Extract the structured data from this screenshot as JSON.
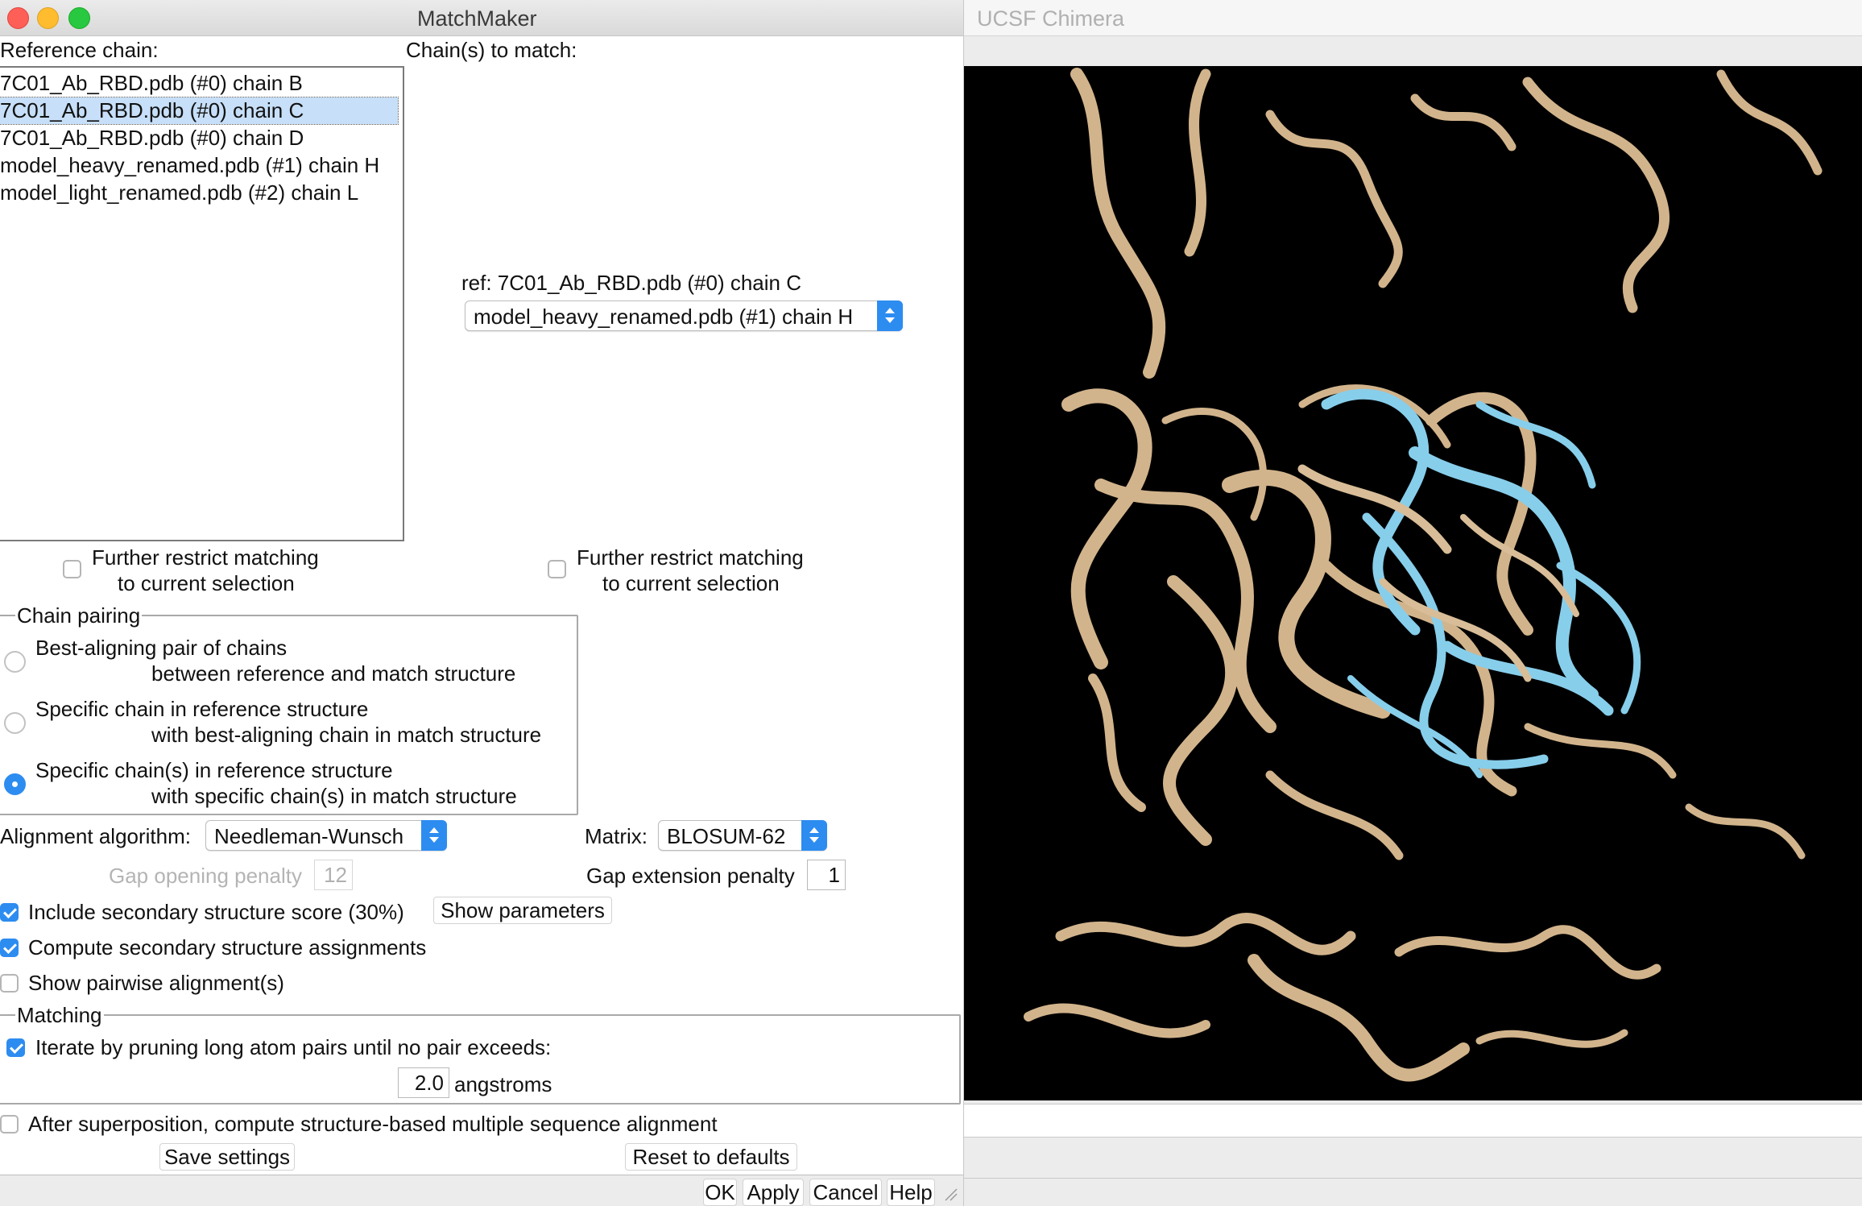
{
  "matchmaker": {
    "title": "MatchMaker",
    "reference_chain_label": "Reference chain:",
    "chains_to_match_label": "Chain(s) to match:",
    "reference_chains": [
      {
        "label": "7C01_Ab_RBD.pdb (#0) chain B",
        "selected": false
      },
      {
        "label": "7C01_Ab_RBD.pdb (#0) chain C",
        "selected": true
      },
      {
        "label": "7C01_Ab_RBD.pdb (#0) chain D",
        "selected": false
      },
      {
        "label": "model_heavy_renamed.pdb (#1) chain H",
        "selected": false
      },
      {
        "label": "model_light_renamed.pdb (#2) chain L",
        "selected": false
      }
    ],
    "ref_text": "ref: 7C01_Ab_RBD.pdb (#0) chain C",
    "match_chain_selected": "model_heavy_renamed.pdb (#1) chain H",
    "restrict_left": {
      "line1": "Further restrict matching",
      "line2": "to current selection",
      "checked": false
    },
    "restrict_right": {
      "line1": "Further restrict matching",
      "line2": "to current selection",
      "checked": false
    },
    "chain_pairing": {
      "title": "Chain pairing",
      "options": [
        {
          "line1": "Best-aligning pair of chains",
          "line2": "between reference and match structure",
          "selected": false
        },
        {
          "line1": "Specific chain in reference structure",
          "line2": "with best-aligning chain in match structure",
          "selected": false
        },
        {
          "line1": "Specific chain(s) in reference structure",
          "line2": "with specific chain(s) in match structure",
          "selected": true
        }
      ]
    },
    "alignment_algorithm_label": "Alignment algorithm:",
    "alignment_algorithm_value": "Needleman-Wunsch",
    "matrix_label": "Matrix:",
    "matrix_value": "BLOSUM-62",
    "gap_opening_label": "Gap opening penalty",
    "gap_opening_value": "12",
    "gap_extension_label": "Gap extension penalty",
    "gap_extension_value": "1",
    "include_ss_label": "Include secondary structure score (30%)",
    "include_ss_checked": true,
    "show_parameters_label": "Show parameters",
    "compute_ss_label": "Compute secondary structure assignments",
    "compute_ss_checked": true,
    "show_pairwise_label": "Show pairwise alignment(s)",
    "show_pairwise_checked": false,
    "matching": {
      "title": "Matching",
      "iterate_label": "Iterate by pruning long atom pairs until no pair exceeds:",
      "iterate_checked": true,
      "cutoff_value": "2.0",
      "cutoff_unit": "angstroms"
    },
    "after_superposition_label": "After superposition, compute structure-based multiple sequence alignment",
    "after_superposition_checked": false,
    "save_settings_label": "Save settings",
    "reset_defaults_label": "Reset to defaults",
    "ok_label": "OK",
    "apply_label": "Apply",
    "cancel_label": "Cancel",
    "help_label": "Help"
  },
  "chimera": {
    "title": "UCSF Chimera",
    "ribbon_colors": {
      "background": "#000000",
      "reference": "#d2b48c",
      "match": "#87ceeb"
    }
  }
}
